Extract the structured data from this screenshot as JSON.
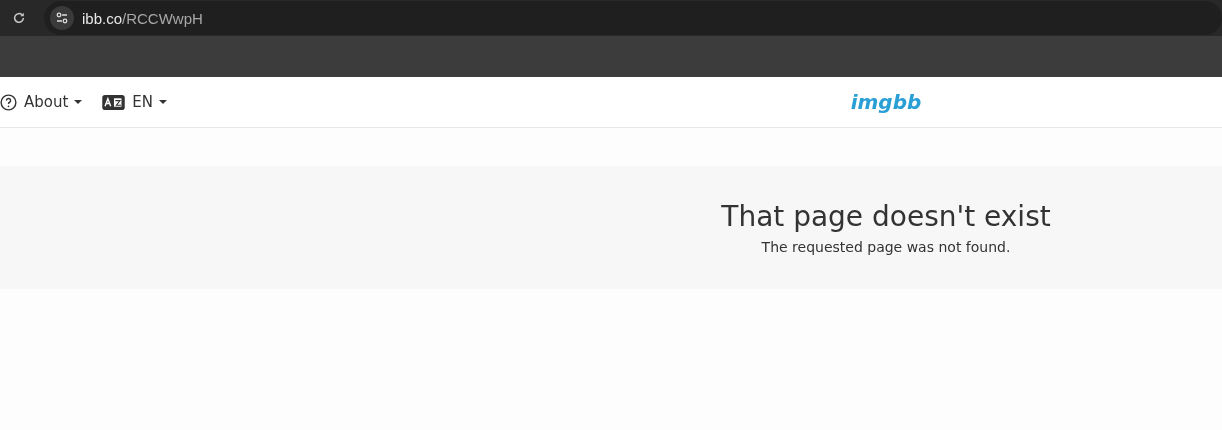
{
  "browser": {
    "url_host": "ibb.co",
    "url_path": "/RCCWwpH"
  },
  "nav": {
    "items": [
      {
        "kind": "help",
        "label": "About"
      },
      {
        "kind": "language",
        "label": "EN"
      }
    ],
    "logo": "imgbb"
  },
  "message": {
    "title": "That page doesn't exist",
    "text": "The requested page was not found."
  }
}
